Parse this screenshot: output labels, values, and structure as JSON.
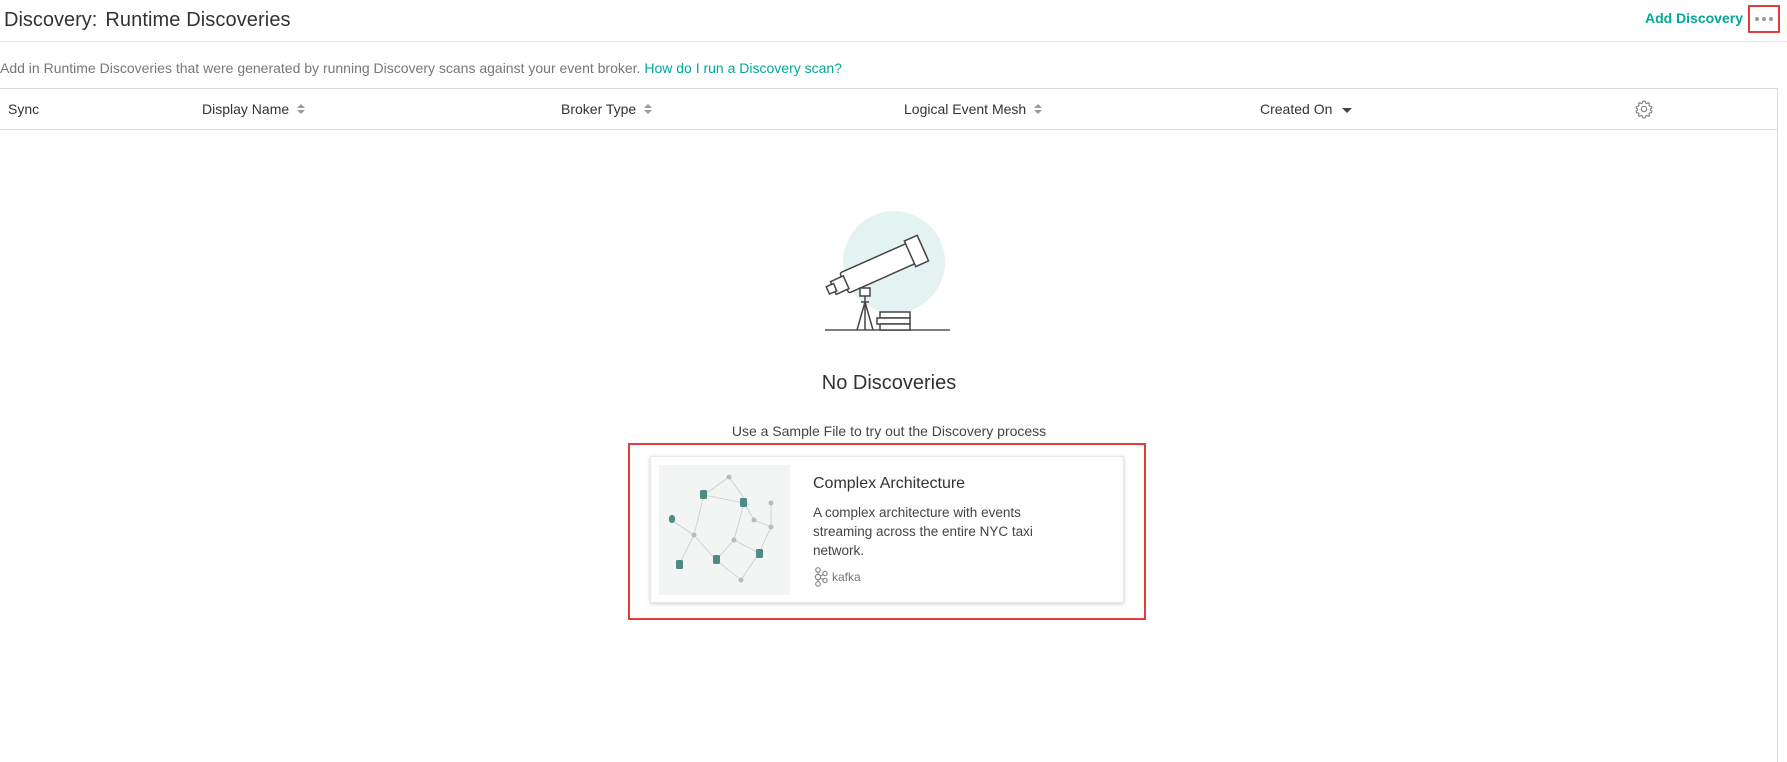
{
  "header": {
    "title_prefix": "Discovery:",
    "title": "Runtime Discoveries",
    "add_discovery_label": "Add Discovery",
    "more_icon": "more-horizontal-icon"
  },
  "description": {
    "text": "Add in Runtime Discoveries that were generated by running Discovery scans against your event broker.",
    "help_link": "How do I run a Discovery scan?"
  },
  "table": {
    "columns": [
      {
        "label": "Sync",
        "sortable": false
      },
      {
        "label": "Display Name",
        "sortable": true
      },
      {
        "label": "Broker Type",
        "sortable": true
      },
      {
        "label": "Logical Event Mesh",
        "sortable": true
      },
      {
        "label": "Created On",
        "sortable": true,
        "sort": "descending"
      }
    ],
    "settings_icon": "gear-icon"
  },
  "empty_state": {
    "title": "No Discoveries",
    "subtitle": "Use a Sample File to try out the Discovery process",
    "illustration": "telescope-illustration"
  },
  "sample_card": {
    "title": "Complex Architecture",
    "description": "A complex architecture with events streaming across the entire NYC taxi network.",
    "technology": "kafka"
  },
  "colors": {
    "accent": "#00a89a",
    "highlight": "#e03c3c",
    "border": "#dcdcdc"
  }
}
